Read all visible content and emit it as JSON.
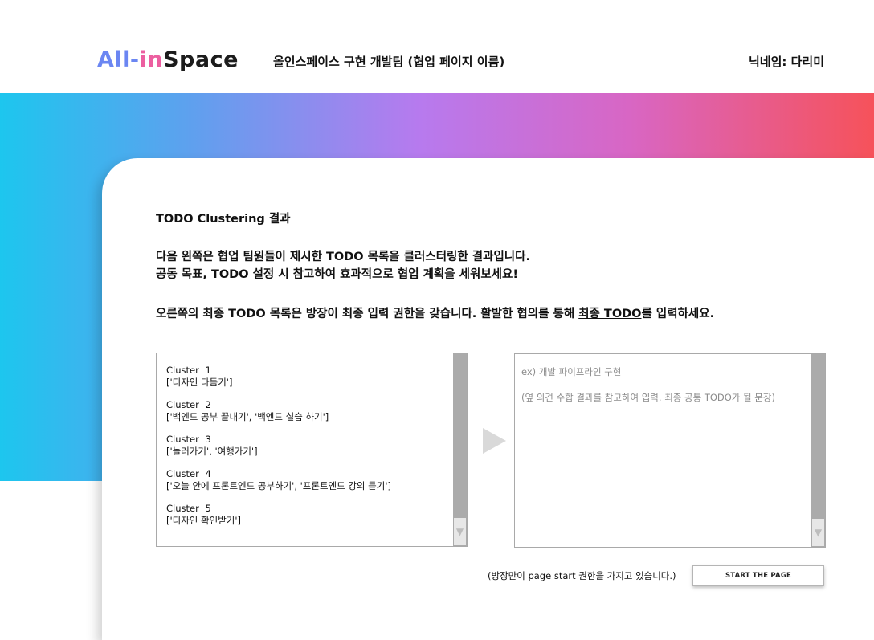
{
  "header": {
    "logo": {
      "part1": "All-",
      "part2": "in",
      "part3": "Space"
    },
    "team_title": "올인스페이스 구현 개발팀 (협업 페이지 이름)",
    "nickname": "닉네임: 다리미"
  },
  "main": {
    "section_title": "TODO Clustering 결과",
    "description_line1": "다음 왼쪽은 협업 팀원들이 제시한 TODO 목록을 클러스터링한 결과입니다.",
    "description_line2": "공동 목표, TODO 설정 시 참고하여 효과적으로 협업 계획을 세워보세요!",
    "notice_prefix": "오른쪽의 최종 TODO 목록은 방장이 최종 입력 권한을 갖습니다. 활발한 협의를 통해 ",
    "notice_underlined": "최종 TODO",
    "notice_suffix": "를 입력하세요."
  },
  "clusters": [
    {
      "name": "Cluster  1",
      "items": "['디자인 다듬기']"
    },
    {
      "name": "Cluster  2",
      "items": "['백엔드 공부 끝내기', '백엔드 실습 하기']"
    },
    {
      "name": "Cluster  3",
      "items": "['놀러가기', '여행가기']"
    },
    {
      "name": "Cluster  4",
      "items": "['오늘 안에 프론트엔드 공부하기', '프론트엔드 강의 듣기']"
    },
    {
      "name": "Cluster  5",
      "items": "['디자인 확인받기']"
    }
  ],
  "final_todo_input": {
    "placeholder_example": "ex) 개발 파이프라인 구현",
    "placeholder_hint": "(옆 의견 수합 결과를 참고하여 입력. 최종 공통 TODO가 될 문장)"
  },
  "footer": {
    "start_note": "(방장만이 page start 권한을 가지고 있습니다.)",
    "start_button_label": "START THE PAGE"
  },
  "colors": {
    "gradient": [
      "#1dc6ee",
      "#5fa0ee",
      "#b77aee",
      "#d866c4",
      "#f6525a"
    ],
    "logo_all": "#6b86f2",
    "logo_in": "#ec5fa0",
    "scrollbar": "#ababab"
  },
  "icons": [
    "scroll-down-icon",
    "arrow-right-icon"
  ]
}
